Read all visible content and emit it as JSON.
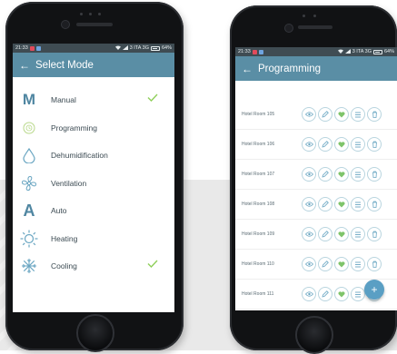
{
  "colors": {
    "accent": "#5a8ea5",
    "statusbar": "#3f4c53",
    "check": "#8fcf5a",
    "icon": "#6aa6c2",
    "heart": "#7ec46a",
    "fab": "#5a9fc4"
  },
  "phone_left": {
    "status": {
      "time": "21:33",
      "network": "3 ITA 3G",
      "battery": "64%"
    },
    "appbar": {
      "back_icon": "arrow-left-icon",
      "title": "Select Mode"
    },
    "modes": [
      {
        "label": "Manual",
        "icon": "manual-icon",
        "selected": true
      },
      {
        "label": "Programming",
        "icon": "programming-icon",
        "selected": false
      },
      {
        "label": "Dehumidification",
        "icon": "drop-icon",
        "selected": false
      },
      {
        "label": "Ventilation",
        "icon": "fan-icon",
        "selected": false
      },
      {
        "label": "Auto",
        "icon": "auto-icon",
        "selected": false
      },
      {
        "label": "Heating",
        "icon": "sun-icon",
        "selected": false
      },
      {
        "label": "Cooling",
        "icon": "snowflake-icon",
        "selected": true
      }
    ],
    "manual_glyph": "M",
    "auto_glyph": "A"
  },
  "phone_right": {
    "status": {
      "time": "21:33",
      "network": "3 ITA 3G",
      "battery": "64%"
    },
    "appbar": {
      "back_icon": "arrow-left-icon",
      "title": "Programming"
    },
    "rooms": [
      {
        "label": "Hotel Room 105"
      },
      {
        "label": "Hotel Room 106"
      },
      {
        "label": "Hotel Room 107"
      },
      {
        "label": "Hotel Room 108"
      },
      {
        "label": "Hotel Room 109"
      },
      {
        "label": "Hotel Room 110"
      },
      {
        "label": "Hotel Room 111"
      }
    ],
    "room_actions": [
      "eye-icon",
      "pencil-icon",
      "heart-icon",
      "list-icon",
      "trash-icon"
    ],
    "fab_label": "+"
  }
}
